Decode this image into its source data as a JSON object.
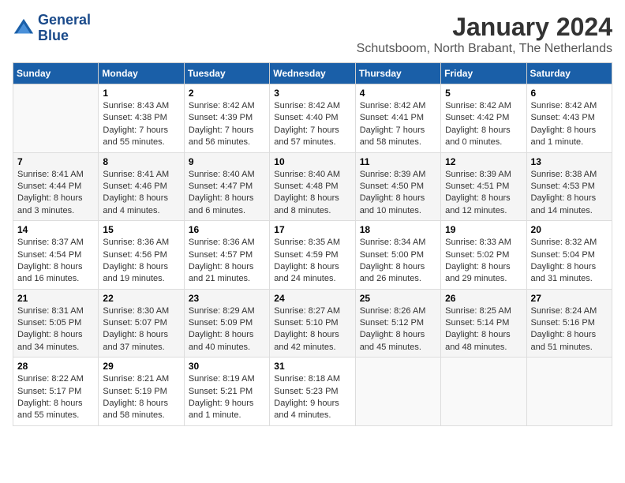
{
  "logo": {
    "line1": "General",
    "line2": "Blue"
  },
  "title": "January 2024",
  "subtitle": "Schutsboom, North Brabant, The Netherlands",
  "weekdays": [
    "Sunday",
    "Monday",
    "Tuesday",
    "Wednesday",
    "Thursday",
    "Friday",
    "Saturday"
  ],
  "weeks": [
    [
      {
        "day": "",
        "sunrise": "",
        "sunset": "",
        "daylight": ""
      },
      {
        "day": "1",
        "sunrise": "Sunrise: 8:43 AM",
        "sunset": "Sunset: 4:38 PM",
        "daylight": "Daylight: 7 hours and 55 minutes."
      },
      {
        "day": "2",
        "sunrise": "Sunrise: 8:42 AM",
        "sunset": "Sunset: 4:39 PM",
        "daylight": "Daylight: 7 hours and 56 minutes."
      },
      {
        "day": "3",
        "sunrise": "Sunrise: 8:42 AM",
        "sunset": "Sunset: 4:40 PM",
        "daylight": "Daylight: 7 hours and 57 minutes."
      },
      {
        "day": "4",
        "sunrise": "Sunrise: 8:42 AM",
        "sunset": "Sunset: 4:41 PM",
        "daylight": "Daylight: 7 hours and 58 minutes."
      },
      {
        "day": "5",
        "sunrise": "Sunrise: 8:42 AM",
        "sunset": "Sunset: 4:42 PM",
        "daylight": "Daylight: 8 hours and 0 minutes."
      },
      {
        "day": "6",
        "sunrise": "Sunrise: 8:42 AM",
        "sunset": "Sunset: 4:43 PM",
        "daylight": "Daylight: 8 hours and 1 minute."
      }
    ],
    [
      {
        "day": "7",
        "sunrise": "Sunrise: 8:41 AM",
        "sunset": "Sunset: 4:44 PM",
        "daylight": "Daylight: 8 hours and 3 minutes."
      },
      {
        "day": "8",
        "sunrise": "Sunrise: 8:41 AM",
        "sunset": "Sunset: 4:46 PM",
        "daylight": "Daylight: 8 hours and 4 minutes."
      },
      {
        "day": "9",
        "sunrise": "Sunrise: 8:40 AM",
        "sunset": "Sunset: 4:47 PM",
        "daylight": "Daylight: 8 hours and 6 minutes."
      },
      {
        "day": "10",
        "sunrise": "Sunrise: 8:40 AM",
        "sunset": "Sunset: 4:48 PM",
        "daylight": "Daylight: 8 hours and 8 minutes."
      },
      {
        "day": "11",
        "sunrise": "Sunrise: 8:39 AM",
        "sunset": "Sunset: 4:50 PM",
        "daylight": "Daylight: 8 hours and 10 minutes."
      },
      {
        "day": "12",
        "sunrise": "Sunrise: 8:39 AM",
        "sunset": "Sunset: 4:51 PM",
        "daylight": "Daylight: 8 hours and 12 minutes."
      },
      {
        "day": "13",
        "sunrise": "Sunrise: 8:38 AM",
        "sunset": "Sunset: 4:53 PM",
        "daylight": "Daylight: 8 hours and 14 minutes."
      }
    ],
    [
      {
        "day": "14",
        "sunrise": "Sunrise: 8:37 AM",
        "sunset": "Sunset: 4:54 PM",
        "daylight": "Daylight: 8 hours and 16 minutes."
      },
      {
        "day": "15",
        "sunrise": "Sunrise: 8:36 AM",
        "sunset": "Sunset: 4:56 PM",
        "daylight": "Daylight: 8 hours and 19 minutes."
      },
      {
        "day": "16",
        "sunrise": "Sunrise: 8:36 AM",
        "sunset": "Sunset: 4:57 PM",
        "daylight": "Daylight: 8 hours and 21 minutes."
      },
      {
        "day": "17",
        "sunrise": "Sunrise: 8:35 AM",
        "sunset": "Sunset: 4:59 PM",
        "daylight": "Daylight: 8 hours and 24 minutes."
      },
      {
        "day": "18",
        "sunrise": "Sunrise: 8:34 AM",
        "sunset": "Sunset: 5:00 PM",
        "daylight": "Daylight: 8 hours and 26 minutes."
      },
      {
        "day": "19",
        "sunrise": "Sunrise: 8:33 AM",
        "sunset": "Sunset: 5:02 PM",
        "daylight": "Daylight: 8 hours and 29 minutes."
      },
      {
        "day": "20",
        "sunrise": "Sunrise: 8:32 AM",
        "sunset": "Sunset: 5:04 PM",
        "daylight": "Daylight: 8 hours and 31 minutes."
      }
    ],
    [
      {
        "day": "21",
        "sunrise": "Sunrise: 8:31 AM",
        "sunset": "Sunset: 5:05 PM",
        "daylight": "Daylight: 8 hours and 34 minutes."
      },
      {
        "day": "22",
        "sunrise": "Sunrise: 8:30 AM",
        "sunset": "Sunset: 5:07 PM",
        "daylight": "Daylight: 8 hours and 37 minutes."
      },
      {
        "day": "23",
        "sunrise": "Sunrise: 8:29 AM",
        "sunset": "Sunset: 5:09 PM",
        "daylight": "Daylight: 8 hours and 40 minutes."
      },
      {
        "day": "24",
        "sunrise": "Sunrise: 8:27 AM",
        "sunset": "Sunset: 5:10 PM",
        "daylight": "Daylight: 8 hours and 42 minutes."
      },
      {
        "day": "25",
        "sunrise": "Sunrise: 8:26 AM",
        "sunset": "Sunset: 5:12 PM",
        "daylight": "Daylight: 8 hours and 45 minutes."
      },
      {
        "day": "26",
        "sunrise": "Sunrise: 8:25 AM",
        "sunset": "Sunset: 5:14 PM",
        "daylight": "Daylight: 8 hours and 48 minutes."
      },
      {
        "day": "27",
        "sunrise": "Sunrise: 8:24 AM",
        "sunset": "Sunset: 5:16 PM",
        "daylight": "Daylight: 8 hours and 51 minutes."
      }
    ],
    [
      {
        "day": "28",
        "sunrise": "Sunrise: 8:22 AM",
        "sunset": "Sunset: 5:17 PM",
        "daylight": "Daylight: 8 hours and 55 minutes."
      },
      {
        "day": "29",
        "sunrise": "Sunrise: 8:21 AM",
        "sunset": "Sunset: 5:19 PM",
        "daylight": "Daylight: 8 hours and 58 minutes."
      },
      {
        "day": "30",
        "sunrise": "Sunrise: 8:19 AM",
        "sunset": "Sunset: 5:21 PM",
        "daylight": "Daylight: 9 hours and 1 minute."
      },
      {
        "day": "31",
        "sunrise": "Sunrise: 8:18 AM",
        "sunset": "Sunset: 5:23 PM",
        "daylight": "Daylight: 9 hours and 4 minutes."
      },
      {
        "day": "",
        "sunrise": "",
        "sunset": "",
        "daylight": ""
      },
      {
        "day": "",
        "sunrise": "",
        "sunset": "",
        "daylight": ""
      },
      {
        "day": "",
        "sunrise": "",
        "sunset": "",
        "daylight": ""
      }
    ]
  ]
}
